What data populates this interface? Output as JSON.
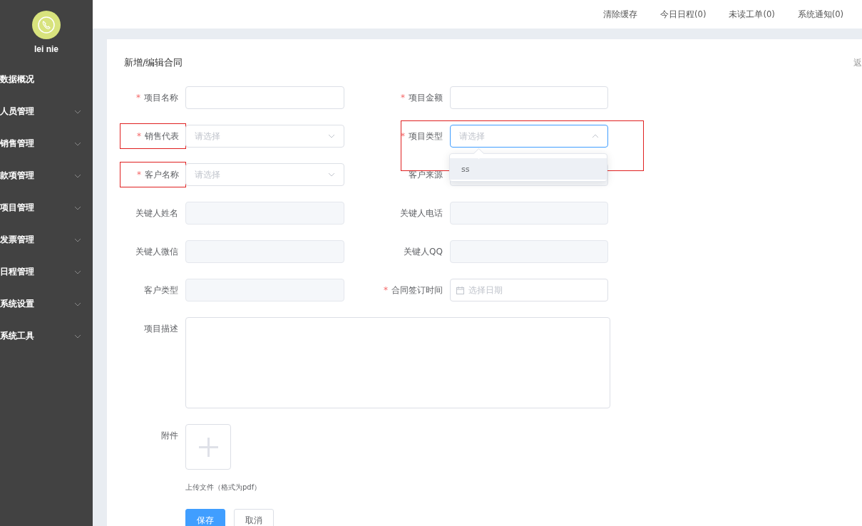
{
  "sidebar": {
    "user": {
      "name": "lei nie"
    },
    "items": [
      {
        "label": "数据概况",
        "kind": "link"
      },
      {
        "label": "人员管理",
        "kind": "submenu",
        "expanded": false
      },
      {
        "label": "销售管理",
        "kind": "submenu",
        "expanded": false
      },
      {
        "label": "款项管理",
        "kind": "submenu",
        "expanded": false
      },
      {
        "label": "项目管理",
        "kind": "submenu",
        "expanded": false
      },
      {
        "label": "发票管理",
        "kind": "submenu",
        "expanded": false
      },
      {
        "label": "日程管理",
        "kind": "submenu",
        "expanded": false
      },
      {
        "label": "系统设置",
        "kind": "submenu",
        "expanded": false
      },
      {
        "label": "系统工具",
        "kind": "submenu",
        "expanded": false
      }
    ]
  },
  "header": {
    "links": [
      "清除缓存",
      "今日日程(0)",
      "未读工单(0)",
      "系统通知(0)"
    ]
  },
  "form": {
    "title": "新增/编辑合同",
    "back_link": "返",
    "fields": [
      {
        "label": "项目名称",
        "required_mark": "*",
        "kind": "input",
        "annotated": false
      },
      {
        "label": "项目金额",
        "required_mark": "*",
        "kind": "input",
        "annotated": false
      },
      {
        "label": "销售代表",
        "required_mark": "*",
        "kind": "select",
        "placeholder": "请选择",
        "annotated": true,
        "open": false
      },
      {
        "label": "项目类型",
        "required_mark": "*",
        "kind": "select",
        "placeholder": "请选择",
        "annotated": true,
        "open": true,
        "options": [
          {
            "label": "ss",
            "highlighted": true
          }
        ]
      },
      {
        "label": "客户名称",
        "required_mark": "*",
        "kind": "select",
        "placeholder": "请选择",
        "annotated": true,
        "open": false
      },
      {
        "label": "客户来源",
        "kind": "readonly",
        "annotated": false
      },
      {
        "label": "关键人姓名",
        "kind": "readonly",
        "annotated": false
      },
      {
        "label": "关键人电话",
        "kind": "readonly",
        "annotated": false
      },
      {
        "label": "关键人微信",
        "kind": "readonly",
        "annotated": false
      },
      {
        "label": "关键人QQ",
        "kind": "readonly",
        "annotated": false
      },
      {
        "label": "客户类型",
        "kind": "readonly",
        "annotated": false
      },
      {
        "label": "合同签订时间",
        "required_mark": "*",
        "kind": "date",
        "placeholder": "选择日期",
        "annotated": false
      },
      {
        "label": "项目描述",
        "kind": "textarea",
        "annotated": false
      },
      {
        "label": "附件",
        "kind": "upload",
        "hint": "上传文件（格式为pdf）",
        "annotated": false
      }
    ],
    "buttons": [
      {
        "label": "保存",
        "kind": "primary"
      },
      {
        "label": "取消",
        "kind": "default"
      }
    ]
  }
}
